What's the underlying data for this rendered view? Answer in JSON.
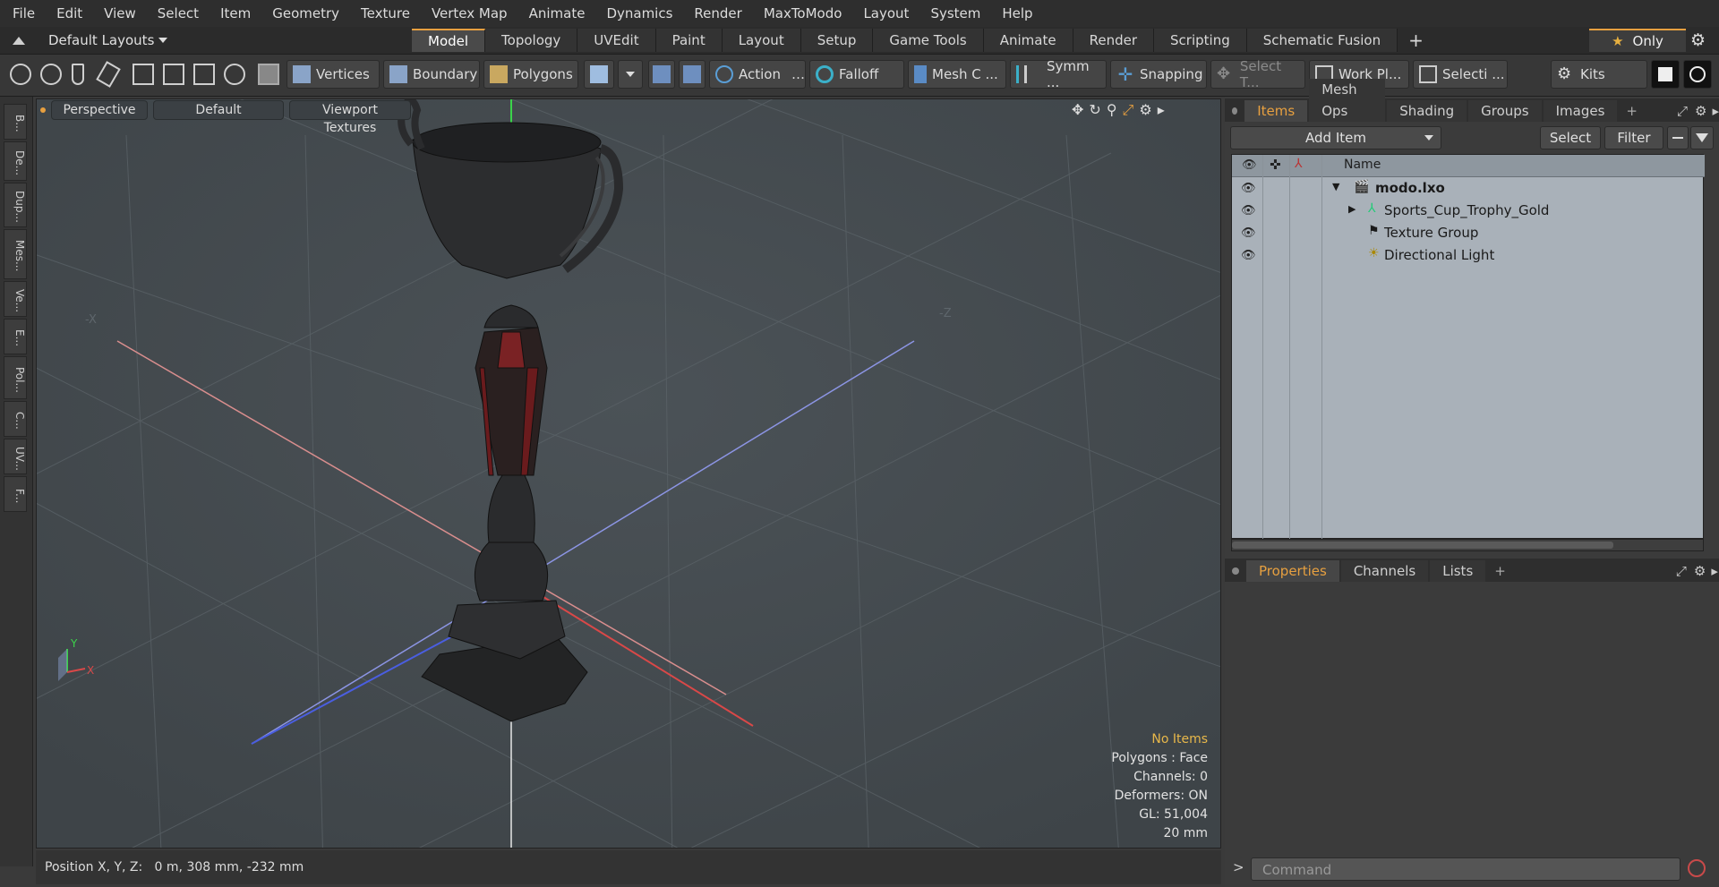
{
  "menu": [
    "File",
    "Edit",
    "View",
    "Select",
    "Item",
    "Geometry",
    "Texture",
    "Vertex Map",
    "Animate",
    "Dynamics",
    "Render",
    "MaxToModo",
    "Layout",
    "System",
    "Help"
  ],
  "layout": {
    "selector": "Default Layouts",
    "tabs": [
      "Model",
      "Topology",
      "UVEdit",
      "Paint",
      "Layout",
      "Setup",
      "Game Tools",
      "Animate",
      "Render",
      "Scripting",
      "Schematic Fusion"
    ],
    "active_tab": "Model",
    "only_label": "Only"
  },
  "toolbar": {
    "vertices": "Vertices",
    "boundary": "Boundary",
    "polygons": "Polygons",
    "action": "Action",
    "falloff": "Falloff",
    "mesh_c": "Mesh C ...",
    "symm": "Symm ...",
    "snapping": "Snapping",
    "select_t": "Select T...",
    "work_pl": "Work Pl...",
    "selecti": "Selecti ...",
    "kits": "Kits"
  },
  "left_tabs": [
    "B...",
    "De...",
    "Dup...",
    "Mes...",
    "Ve...",
    "E...",
    "Pol...",
    "C...",
    "UV...",
    "F..."
  ],
  "viewport": {
    "perspective": "Perspective",
    "default": "Default",
    "textures": "Viewport Textures",
    "axis_labels": {
      "neg_x": "-X",
      "neg_z": "-Z",
      "y": "Y",
      "x": "X"
    },
    "info": {
      "selection": "No Items",
      "polygons": "Polygons : Face",
      "channels": "Channels: 0",
      "deformers": "Deformers: ON",
      "gl": "GL: 51,004",
      "size": "20 mm"
    },
    "colors": {
      "selection_text": "#e8b84a",
      "x_axis": "#d94848",
      "z_axis": "#4a5ee0",
      "y_axis": "#3bd34a"
    }
  },
  "status": {
    "position": "Position X, Y, Z:   0 m, 308 mm, -232 mm"
  },
  "items_panel": {
    "tabs": [
      "Items",
      "Mesh Ops",
      "Shading",
      "Groups",
      "Images"
    ],
    "active_tab": "Items",
    "add_item": "Add Item",
    "select": "Select",
    "filter": "Filter",
    "column_name": "Name",
    "rows": [
      {
        "label": "modo.lxo",
        "bold": true
      },
      {
        "label": "Sports_Cup_Trophy_Gold",
        "bold": false
      },
      {
        "label": "Texture Group",
        "bold": false
      },
      {
        "label": "Directional Light",
        "bold": false
      }
    ]
  },
  "properties_panel": {
    "tabs": [
      "Properties",
      "Channels",
      "Lists"
    ],
    "active_tab": "Properties"
  },
  "command": {
    "placeholder": "Command"
  }
}
